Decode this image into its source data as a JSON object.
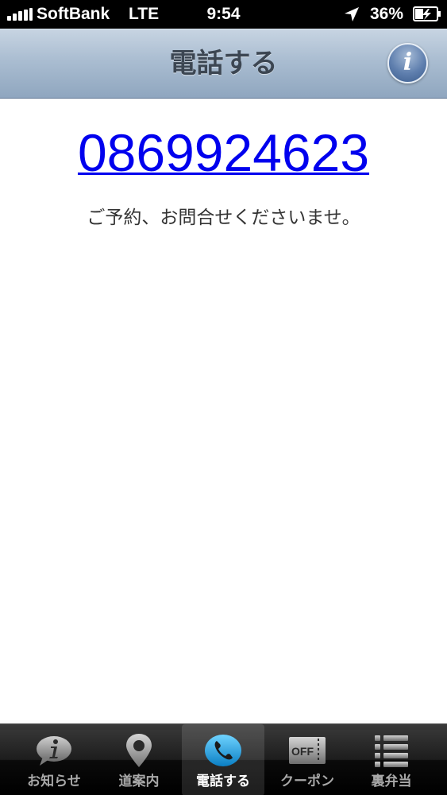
{
  "status_bar": {
    "carrier": "SoftBank",
    "network": "LTE",
    "time": "9:54",
    "battery": "36%"
  },
  "nav": {
    "title": "電話する",
    "info_label": "i"
  },
  "main": {
    "phone_number": "0869924623",
    "message": "ご予約、お問合せくださいませ。"
  },
  "tabs": [
    {
      "label": "お知らせ",
      "icon": "info-icon",
      "active": false
    },
    {
      "label": "道案内",
      "icon": "map-pin-icon",
      "active": false
    },
    {
      "label": "電話する",
      "icon": "phone-icon",
      "active": true
    },
    {
      "label": "クーポン",
      "icon": "coupon-icon",
      "active": false
    },
    {
      "label": "裏弁当",
      "icon": "list-icon",
      "active": false
    }
  ],
  "coupon_icon_text": "OFF"
}
